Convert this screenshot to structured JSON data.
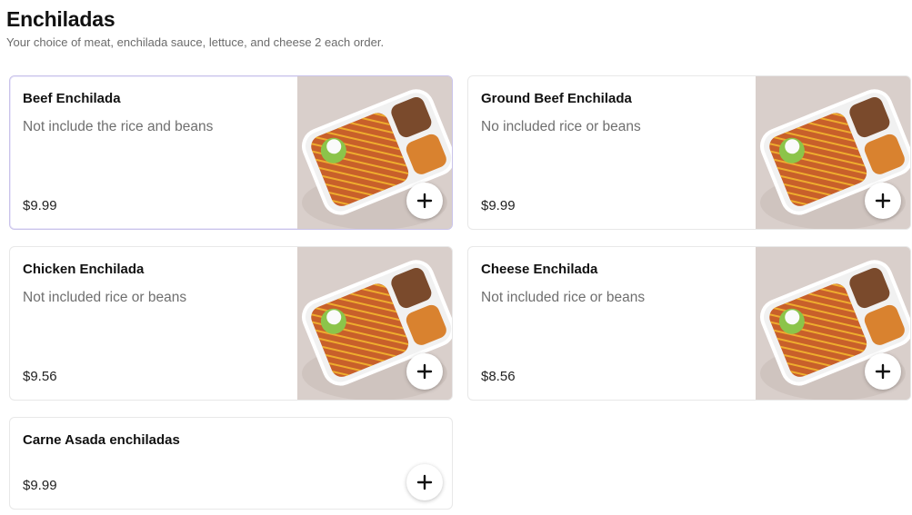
{
  "section": {
    "title": "Enchiladas",
    "subtitle": "Your choice of meat, enchilada sauce, lettuce, and cheese 2 each order."
  },
  "items": [
    {
      "name": "Beef Enchilada",
      "description": "Not include the rice and beans",
      "price": "$9.99",
      "has_image": true,
      "image_icon": "enchilada-tray-photo"
    },
    {
      "name": "Ground Beef Enchilada",
      "description": "No included rice or beans",
      "price": "$9.99",
      "has_image": true,
      "image_icon": "enchilada-tray-photo"
    },
    {
      "name": "Chicken Enchilada",
      "description": "Not included rice or beans",
      "price": "$9.56",
      "has_image": true,
      "image_icon": "enchilada-tray-photo"
    },
    {
      "name": "Cheese Enchilada",
      "description": "Not included rice or beans",
      "price": "$8.56",
      "has_image": true,
      "image_icon": "enchilada-tray-photo"
    },
    {
      "name": "Carne Asada enchiladas",
      "description": "",
      "price": "$9.99",
      "has_image": false
    }
  ],
  "add_button_icon": "plus-icon",
  "colors": {
    "accent_border": "#c9c3ea",
    "text": "#191919",
    "muted": "#6f6f6f"
  }
}
